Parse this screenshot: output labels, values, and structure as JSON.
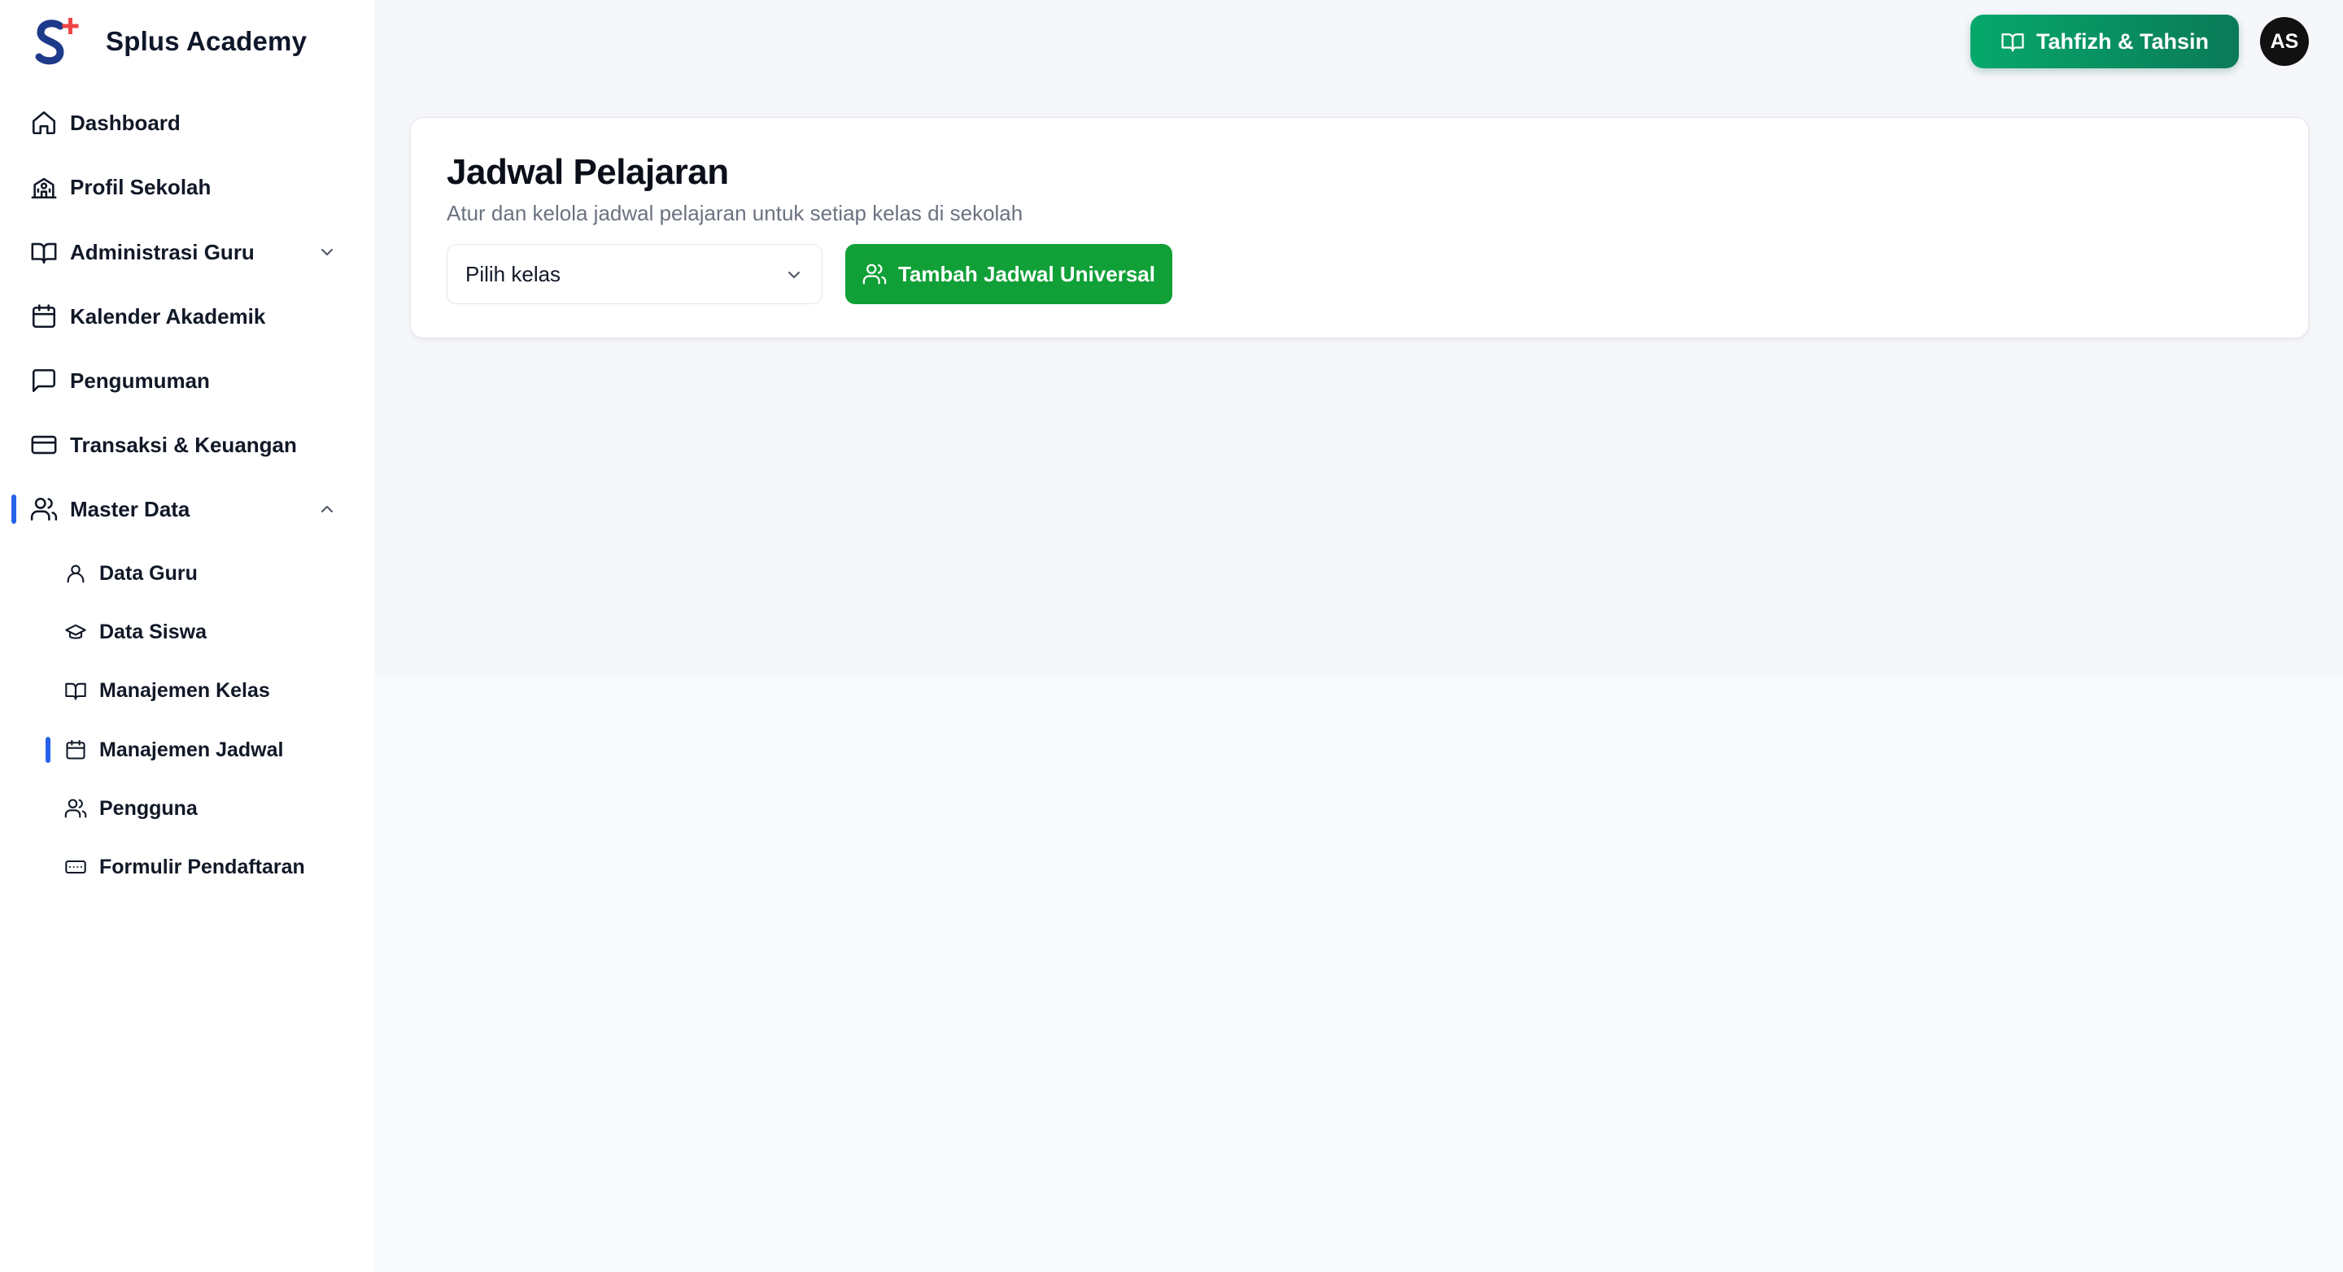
{
  "brand": {
    "name": "Splus Academy",
    "logo_icon": "splus-logo-icon"
  },
  "sidebar": {
    "items": [
      {
        "label": "Dashboard",
        "icon": "home-icon"
      },
      {
        "label": "Profil Sekolah",
        "icon": "school-icon"
      },
      {
        "label": "Administrasi Guru",
        "icon": "book-open-icon"
      },
      {
        "label": "Kalender Akademik",
        "icon": "calendar-icon"
      },
      {
        "label": "Pengumuman",
        "icon": "message-square-icon"
      },
      {
        "label": "Transaksi & Keuangan",
        "icon": "credit-card-icon"
      },
      {
        "label": "Master Data",
        "icon": "users-icon"
      }
    ],
    "master_data_children": [
      {
        "label": "Data Guru",
        "icon": "user-icon"
      },
      {
        "label": "Data Siswa",
        "icon": "graduation-cap-icon"
      },
      {
        "label": "Manajemen Kelas",
        "icon": "book-open-icon"
      },
      {
        "label": "Manajemen Jadwal",
        "icon": "calendar-icon"
      },
      {
        "label": "Pengguna",
        "icon": "users-icon"
      },
      {
        "label": "Formulir Pendaftaran",
        "icon": "form-icon"
      }
    ],
    "accent_color": "#2563eb"
  },
  "header": {
    "tahfizh_button": "Tahfizh & Tahsin",
    "avatar_initials": "AS"
  },
  "page": {
    "title": "Jadwal Pelajaran",
    "subtitle": "Atur dan kelola jadwal pelajaran untuk setiap kelas di sekolah",
    "class_select_value": "Pilih kelas",
    "add_universal_button": "Tambah Jadwal Universal",
    "primary_color": "#10a037"
  }
}
